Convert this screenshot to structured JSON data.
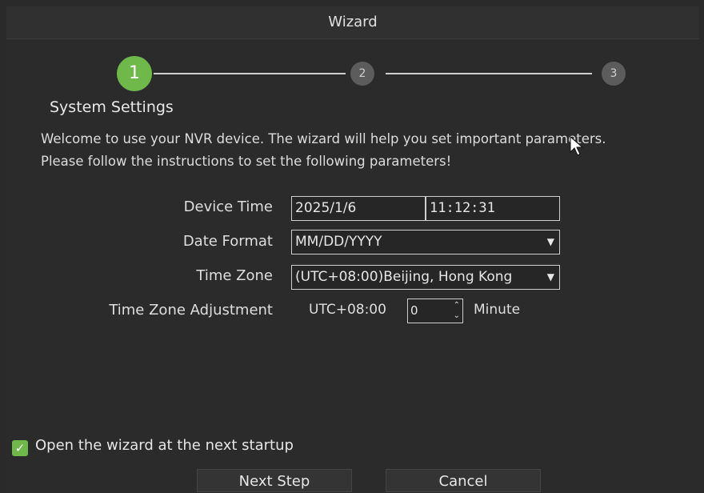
{
  "window": {
    "title": "Wizard"
  },
  "steps": [
    "1",
    "2",
    "3"
  ],
  "section": {
    "title": "System Settings",
    "welcome_line1": "Welcome to use your NVR device. The wizard will help you set important parameters.",
    "welcome_line2": "Please follow the instructions to set the following parameters!"
  },
  "form": {
    "device_time_label": "Device Time",
    "device_date": "2025/1/6",
    "device_clock": "11:12:31",
    "date_format_label": "Date Format",
    "date_format_value": "MM/DD/YYYY",
    "time_zone_label": "Time Zone",
    "time_zone_value": "(UTC+08:00)Beijing, Hong Kong",
    "tz_adjust_label": "Time Zone Adjustment",
    "tz_adjust_prefix": "UTC+08:00",
    "tz_adjust_value": "0",
    "tz_adjust_unit": "Minute"
  },
  "startup": {
    "checked": true,
    "label": "Open the wizard at the next startup"
  },
  "buttons": {
    "next": "Next Step",
    "cancel": "Cancel"
  },
  "colors": {
    "accent": "#6fb94a",
    "background": "#2b2b2b"
  }
}
